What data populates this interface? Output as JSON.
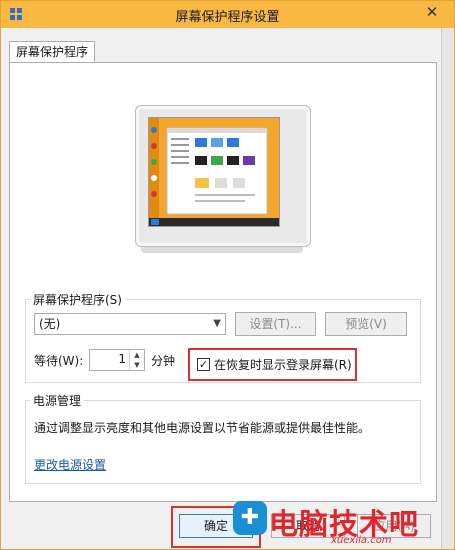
{
  "window": {
    "title": "屏幕保护程序设置",
    "close_glyph": "✕"
  },
  "tab": {
    "label": "屏幕保护程序"
  },
  "screensaver": {
    "group_label": "屏幕保护程序(S)",
    "selected": "(无)",
    "settings_button": "设置(T)...",
    "preview_button": "预览(V)",
    "wait_label": "等待(W):",
    "wait_value": "1",
    "minutes_label": "分钟",
    "resume_checkbox_label": "在恢复时显示登录屏幕(R)",
    "resume_checked": true
  },
  "power": {
    "group_label": "电源管理",
    "description": "通过调整显示亮度和其他电源设置以节省能源或提供最佳性能。",
    "link": "更改电源设置"
  },
  "footer": {
    "ok_button": "确定",
    "cancel_button": "取消",
    "apply_button": "应用(A)"
  },
  "watermark": {
    "text": "电脑技术吧",
    "url": "xuexila.com"
  },
  "colors": {
    "titlebar": "#f8b842",
    "highlight": "#d9342b",
    "link": "#1a5aa8"
  }
}
